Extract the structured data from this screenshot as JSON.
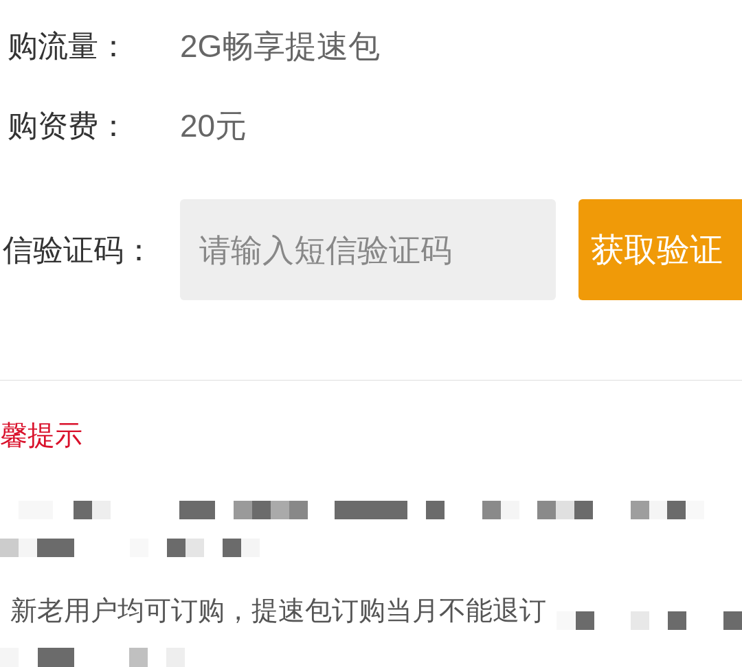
{
  "order_info": {
    "rows": [
      {
        "label": "购流量：",
        "value": "2G畅享提速包"
      },
      {
        "label": "购资费：",
        "value": "20元"
      }
    ]
  },
  "verification": {
    "label": "信验证码：",
    "input": {
      "placeholder": "请输入短信验证码"
    },
    "button": "获取验证"
  },
  "tips": {
    "title": "馨提示",
    "items": [
      "新老用户均可订购，提速包订购当月不能退订"
    ]
  }
}
